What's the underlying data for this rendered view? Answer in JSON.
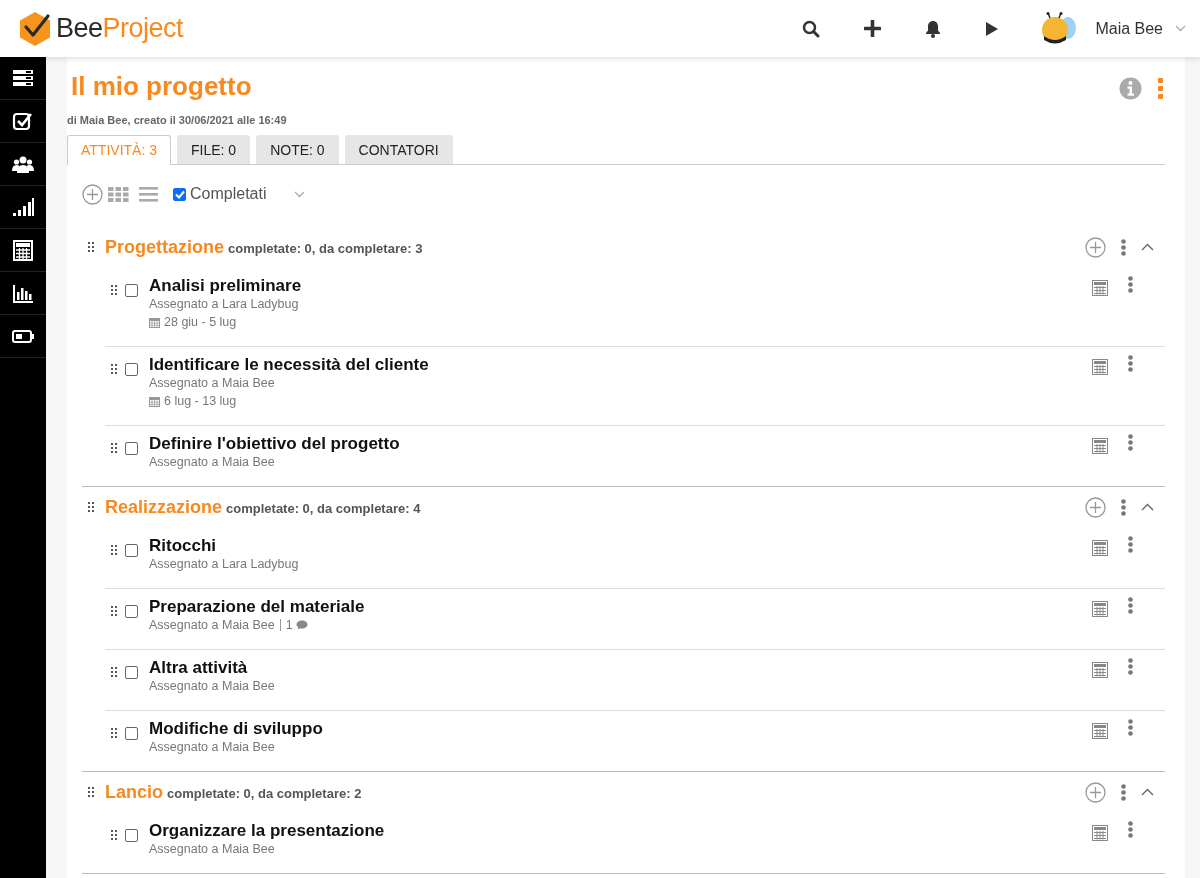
{
  "header": {
    "brand_first": "Bee",
    "brand_second": "Project",
    "user_name": "Maia Bee"
  },
  "project": {
    "title": "Il mio progetto",
    "meta": "di Maia Bee, creato il 30/06/2021 alle 16:49"
  },
  "tabs": [
    {
      "label": "ATTIVITÀ: 3",
      "selected": true
    },
    {
      "label": "FILE: 0",
      "selected": false
    },
    {
      "label": "NOTE: 0",
      "selected": false
    },
    {
      "label": "CONTATORI",
      "selected": false
    }
  ],
  "toolbar": {
    "completed_label": "Completati",
    "completed_checked": true
  },
  "groups": [
    {
      "name": "Progettazione",
      "summary": "completate: 0, da completare: 3",
      "expanded": true,
      "tasks": [
        {
          "title": "Analisi preliminare",
          "assignee": "Assegnato a Lara Ladybug",
          "dates": "28 giu - 5 lug",
          "done": false
        },
        {
          "title": "Identificare le necessità del cliente",
          "assignee": "Assegnato a Maia Bee",
          "dates": "6 lug - 13 lug",
          "done": false
        },
        {
          "title": "Definire l'obiettivo del progetto",
          "assignee": "Assegnato a Maia Bee",
          "done": false
        }
      ]
    },
    {
      "name": "Realizzazione",
      "summary": "completate: 0, da completare: 4",
      "expanded": true,
      "tasks": [
        {
          "title": "Ritocchi",
          "assignee": "Assegnato a Lara Ladybug",
          "done": false
        },
        {
          "title": "Preparazione del materiale",
          "assignee": "Assegnato a Maia Bee",
          "comments": "1",
          "done": false
        },
        {
          "title": "Altra attività",
          "assignee": "Assegnato a Maia Bee",
          "done": false
        },
        {
          "title": "Modifiche di sviluppo",
          "assignee": "Assegnato a Maia Bee",
          "done": false
        }
      ]
    },
    {
      "name": "Lancio",
      "summary": "completate: 0, da completare: 2",
      "expanded": true,
      "tasks": [
        {
          "title": "Organizzare la presentazione",
          "assignee": "Assegnato a Maia Bee",
          "done": false
        }
      ]
    }
  ]
}
